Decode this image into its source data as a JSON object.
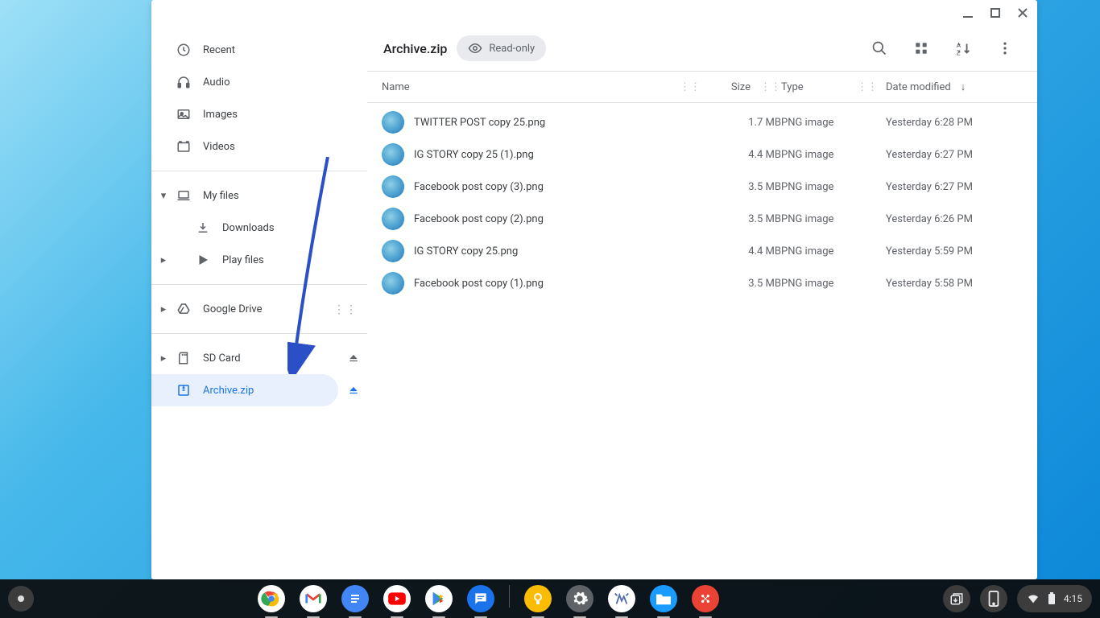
{
  "sidebar": {
    "recent": "Recent",
    "audio": "Audio",
    "images": "Images",
    "videos": "Videos",
    "my_files": "My files",
    "downloads": "Downloads",
    "play_files": "Play files",
    "google_drive": "Google Drive",
    "sd_card": "SD Card",
    "archive": "Archive.zip"
  },
  "main": {
    "title": "Archive.zip",
    "readonly": "Read-only",
    "columns": {
      "name": "Name",
      "size": "Size",
      "type": "Type",
      "date": "Date modified"
    },
    "files": [
      {
        "name": "TWITTER POST copy 25.png",
        "size": "1.7 MB",
        "type": "PNG image",
        "date": "Yesterday 6:28 PM"
      },
      {
        "name": "IG STORY copy 25 (1).png",
        "size": "4.4 MB",
        "type": "PNG image",
        "date": "Yesterday 6:27 PM"
      },
      {
        "name": "Facebook post copy (3).png",
        "size": "3.5 MB",
        "type": "PNG image",
        "date": "Yesterday 6:27 PM"
      },
      {
        "name": "Facebook post copy (2).png",
        "size": "3.5 MB",
        "type": "PNG image",
        "date": "Yesterday 6:26 PM"
      },
      {
        "name": "IG STORY copy 25.png",
        "size": "4.4 MB",
        "type": "PNG image",
        "date": "Yesterday 5:59 PM"
      },
      {
        "name": "Facebook post copy (1).png",
        "size": "3.5 MB",
        "type": "PNG image",
        "date": "Yesterday 5:58 PM"
      }
    ]
  },
  "status": {
    "time": "4:15"
  }
}
